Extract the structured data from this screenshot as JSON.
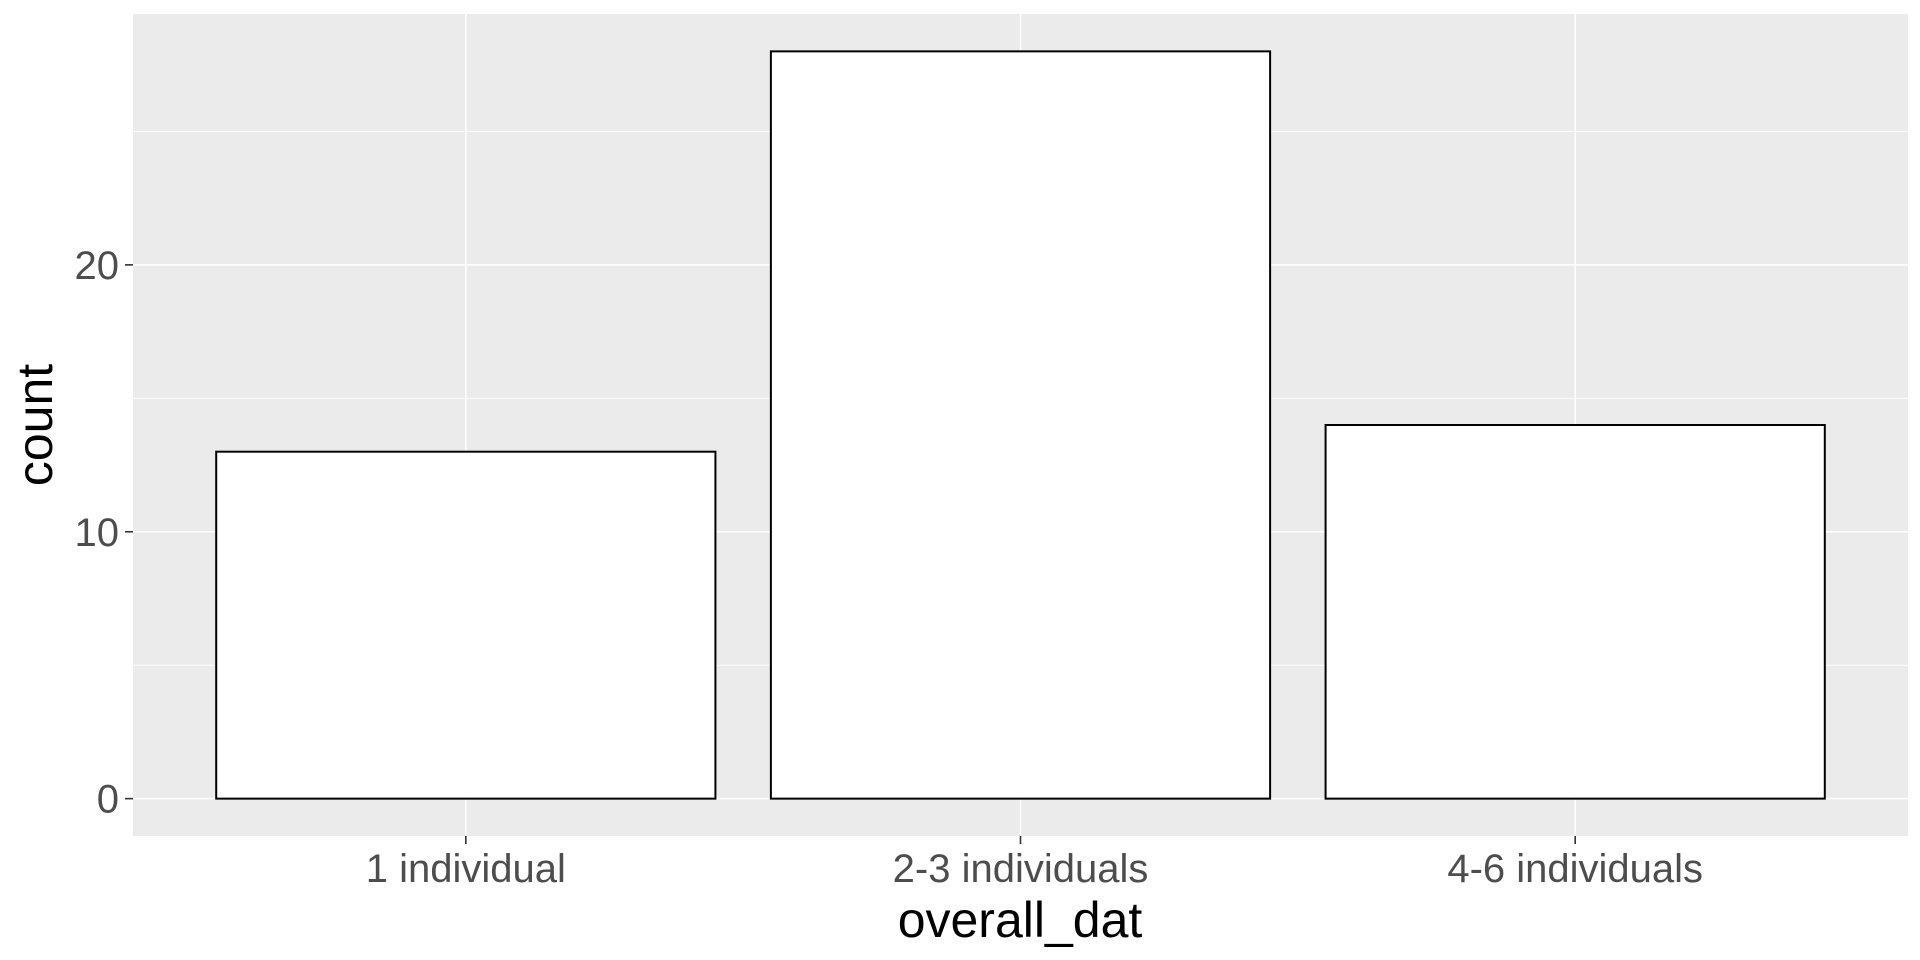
{
  "chart_data": {
    "type": "bar",
    "categories": [
      "1 individual",
      "2-3 individuals",
      "4-6 individuals"
    ],
    "values": [
      13,
      28,
      14
    ],
    "xlabel": "overall_dat",
    "ylabel": "count",
    "ylim": [
      -1.4,
      29.4
    ],
    "y_ticks": [
      0,
      10,
      20
    ],
    "y_minor_ticks": [
      5,
      15,
      25
    ],
    "grid": true,
    "colors": {
      "panel": "#ebebeb",
      "bar_fill": "#ffffff",
      "bar_outline": "#000000"
    }
  }
}
